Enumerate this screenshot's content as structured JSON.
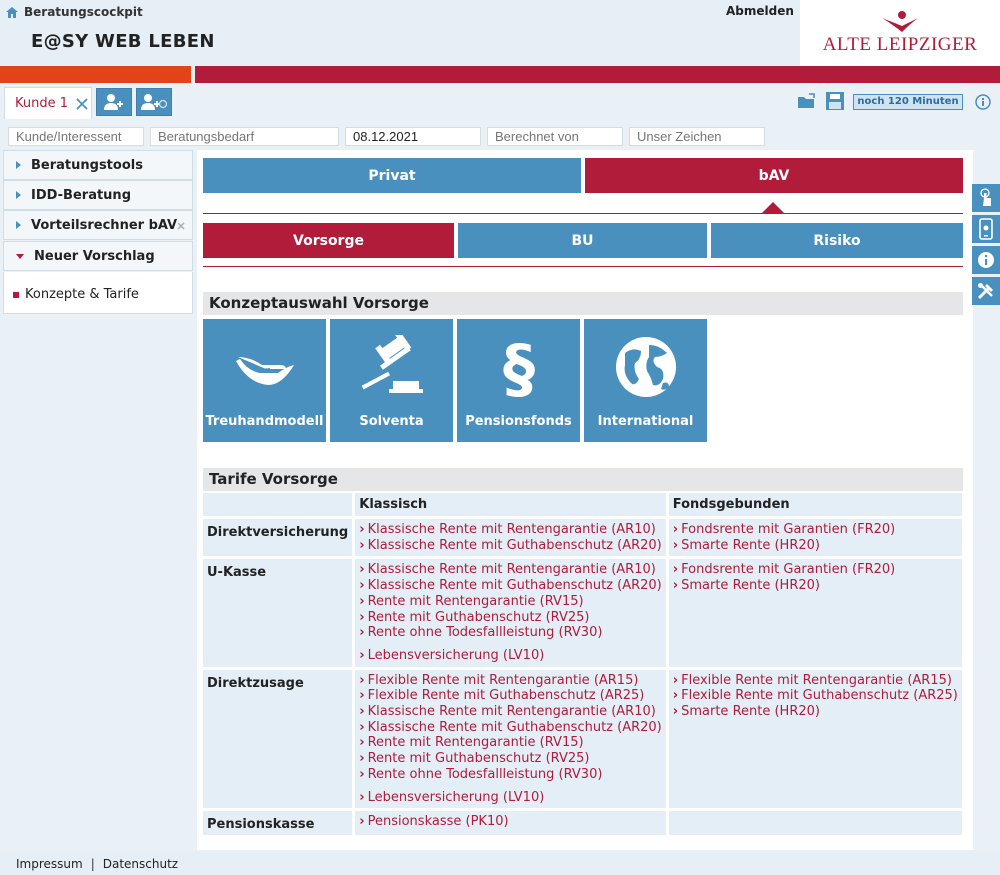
{
  "header": {
    "breadcrumb": "Beratungscockpit",
    "app_title": "E@SY WEB LEBEN",
    "logout": "Abmelden",
    "logo": "ALTE LEIPZIGER"
  },
  "tabs": {
    "active": "Kunde 1",
    "timer": "noch 120 Minuten"
  },
  "fields": {
    "customer_placeholder": "Kunde/Interessent",
    "need_placeholder": "Beratungsbedarf",
    "date": "08.12.2021",
    "calc_by_placeholder": "Berechnet von",
    "sign_placeholder": "Unser Zeichen"
  },
  "sidebar": {
    "items": [
      {
        "label": "Beratungstools"
      },
      {
        "label": "IDD-Beratung"
      },
      {
        "label": "Vorteilsrechner bAV"
      },
      {
        "label": "Neuer Vorschlag"
      }
    ],
    "sub_item": "Konzepte & Tarife"
  },
  "main": {
    "tabs": {
      "privat": "Privat",
      "bav": "bAV"
    },
    "subtabs": {
      "vorsorge": "Vorsorge",
      "bu": "BU",
      "risiko": "Risiko"
    },
    "concepts_title": "Konzeptauswahl Vorsorge",
    "concepts": [
      {
        "label": "Treuhandmodell"
      },
      {
        "label": "Solventa"
      },
      {
        "label": "Pensionsfonds"
      },
      {
        "label": "International"
      }
    ],
    "tariffs_title": "Tarife Vorsorge",
    "tariffs": {
      "col_classic": "Klassisch",
      "col_fund": "Fondsgebunden",
      "rows": [
        {
          "name": "Direktversicherung",
          "classic": [
            "Klassische Rente mit Rentengarantie (AR10)",
            "Klassische Rente mit Guthabenschutz (AR20)"
          ],
          "fund": [
            "Fondsrente mit Garantien (FR20)",
            "Smarte Rente (HR20)"
          ]
        },
        {
          "name": "U-Kasse",
          "classic": [
            "Klassische Rente mit Rentengarantie (AR10)",
            "Klassische Rente mit Guthabenschutz (AR20)",
            "Rente mit Rentengarantie (RV15)",
            "Rente mit Guthabenschutz (RV25)",
            "Rente ohne Todesfallleistung (RV30)"
          ],
          "classic_extra": "Lebensversicherung (LV10)",
          "fund": [
            "Fondsrente mit Garantien (FR20)",
            "Smarte Rente (HR20)"
          ]
        },
        {
          "name": "Direktzusage",
          "classic": [
            "Flexible Rente mit Rentengarantie (AR15)",
            "Flexible Rente mit Guthabenschutz (AR25)",
            "Klassische Rente mit Rentengarantie (AR10)",
            "Klassische Rente mit Guthabenschutz (AR20)",
            "Rente mit Rentengarantie (RV15)",
            "Rente mit Guthabenschutz (RV25)",
            "Rente ohne Todesfallleistung (RV30)"
          ],
          "classic_extra": "Lebensversicherung (LV10)",
          "fund": [
            "Flexible Rente mit Rentengarantie (AR15)",
            "Flexible Rente mit Guthabenschutz (AR25)",
            "Smarte Rente (HR20)"
          ]
        },
        {
          "name": "Pensionskasse",
          "classic": [
            "Pensionskasse (PK10)"
          ],
          "fund": []
        }
      ]
    }
  },
  "footer": {
    "impressum": "Impressum",
    "datenschutz": "Datenschutz"
  },
  "colors": {
    "brand_red": "#b01c3a",
    "blue": "#4a90bf",
    "orange": "#e04418"
  }
}
